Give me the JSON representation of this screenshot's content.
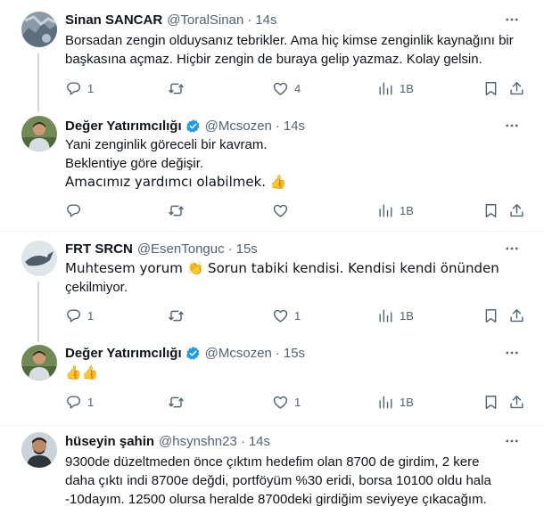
{
  "tweets": [
    {
      "name": "Sinan SANCAR",
      "handle": "@ToralSinan",
      "dot": "·",
      "time": "14s",
      "verified": false,
      "lines": [
        "Borsadan zengin olduysanız tebrikler. Ama hiç kimse zenginlik kaynağını bir",
        "başkasına açmaz. Hiçbir zengin de buraya gelip yazmaz. Kolay gelsin."
      ],
      "replies": "1",
      "retweets": "",
      "likes": "4",
      "views": "1B"
    },
    {
      "name": "Değer Yatırımcılığı",
      "handle": "@Mcsozen",
      "dot": "·",
      "time": "14s",
      "verified": true,
      "lines": [
        "Yani zenginlik göreceli bir kavram.",
        "Beklentiye göre değişir.",
        "Amacımız yardımcı olabilmek. 👍"
      ],
      "replies": "",
      "retweets": "",
      "likes": "",
      "views": "1B"
    },
    {
      "name": "FRT SRCN",
      "handle": "@EsenTonguc",
      "dot": "·",
      "time": "15s",
      "verified": false,
      "lines": [
        "Muhtesem yorum 👏  Sorun tabiki kendisi. Kendisi kendi önünden",
        "çekilmiyor."
      ],
      "replies": "1",
      "retweets": "",
      "likes": "1",
      "views": "1B"
    },
    {
      "name": "Değer Yatırımcılığı",
      "handle": "@Mcsozen",
      "dot": "·",
      "time": "15s",
      "verified": true,
      "lines": [
        "👍👍"
      ],
      "replies": "1",
      "retweets": "",
      "likes": "1",
      "views": "1B"
    },
    {
      "name": "hüseyin şahin",
      "handle": "@hsynshn23",
      "dot": "·",
      "time": "14s",
      "verified": false,
      "lines": [
        "9300de düzeltmeden önce çıktım hedefim olan 8700 de girdim, 2 kere",
        "daha çıktı indi 8700e değdi, portföyüm %30 eridi, borsa 10100 oldu hala",
        "-10dayım. 12500 olursa heralde 8700deki girdiğim seviyeye çıkacağım."
      ]
    }
  ],
  "colors": {
    "text": "#0f1419",
    "secondary": "#536471",
    "verified": "#1d9bf0",
    "thread_line": "#cfd9de",
    "separator": "#eff3f4"
  },
  "icons": [
    "more-icon",
    "reply-icon",
    "retweet-icon",
    "like-icon",
    "views-icon",
    "bookmark-icon",
    "share-icon",
    "verified-badge-icon"
  ]
}
